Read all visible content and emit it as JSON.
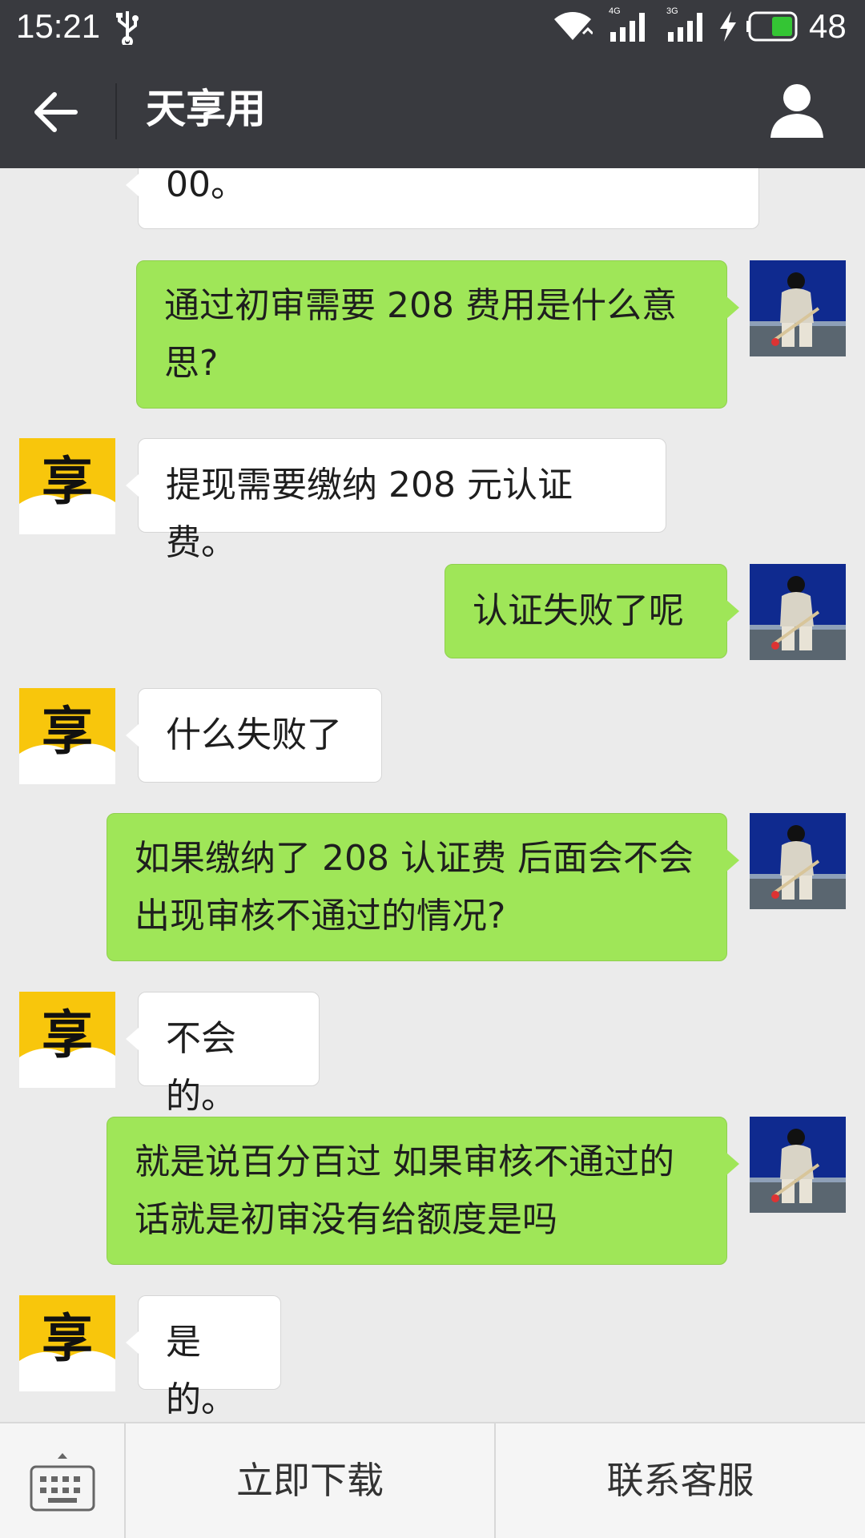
{
  "status_bar": {
    "time": "15:21",
    "network_1": "4G",
    "network_2": "3G",
    "battery": "48",
    "icons": [
      "usb-icon",
      "wifi-icon",
      "signal-icon",
      "charging-icon",
      "battery-icon"
    ]
  },
  "header": {
    "title": "天享用",
    "back_icon": "arrow-left-icon",
    "profile_icon": "person-icon"
  },
  "messages": [
    {
      "from": "bot",
      "lines": [
        "00。"
      ]
    },
    {
      "from": "user",
      "lines": [
        "通过初审需要 208 费用是什么意",
        "思?"
      ]
    },
    {
      "from": "bot",
      "lines": [
        "提现需要缴纳 208 元认证费。"
      ]
    },
    {
      "from": "user",
      "lines": [
        "认证失败了呢"
      ]
    },
    {
      "from": "bot",
      "lines": [
        "什么失败了"
      ]
    },
    {
      "from": "user",
      "lines": [
        "如果缴纳了 208 认证费 后面会不会",
        "出现审核不通过的情况?"
      ]
    },
    {
      "from": "bot",
      "lines": [
        "不会的。"
      ]
    },
    {
      "from": "user",
      "lines": [
        "就是说百分百过 如果审核不通过的",
        "话就是初审没有给额度是吗"
      ]
    },
    {
      "from": "bot",
      "lines": [
        "是的。"
      ]
    }
  ],
  "bot_avatar": {
    "glyph": "享",
    "bg": "#f8c60c"
  },
  "bottom_menu": {
    "keyboard_icon": "keyboard-icon",
    "download": "立即下载",
    "contact": "联系客服"
  },
  "colors": {
    "bar": "#393a3f",
    "chat_bg": "#ebebeb",
    "out_bubble": "#9fe658",
    "in_bubble": "#ffffff"
  }
}
